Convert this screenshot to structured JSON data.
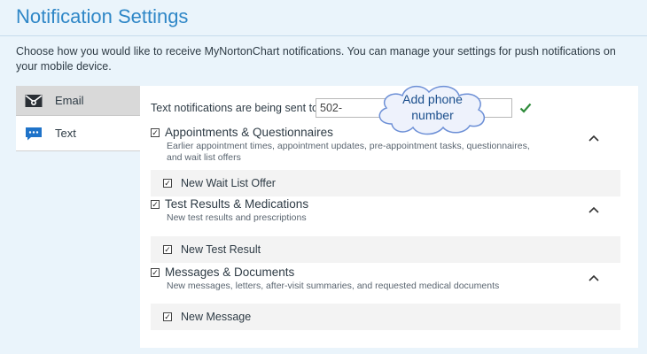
{
  "page": {
    "title": "Notification Settings",
    "intro": "Choose how you would like to receive MyNortonChart notifications. You can manage your settings for push notifications on your mobile device."
  },
  "tabs": [
    {
      "label": "Email",
      "icon": "envelope-icon"
    },
    {
      "label": "Text",
      "icon": "chat-bubble-icon"
    }
  ],
  "text_settings": {
    "send_label": "Text notifications are being sent to:",
    "phone_value": "502-",
    "verified_icon": "check-icon",
    "callout": "Add phone number"
  },
  "sections": [
    {
      "title": "Appointments & Questionnaires",
      "description": "Earlier appointment times, appointment updates, pre-appointment tasks, questionnaires, and wait list offers",
      "sub_label": "New Wait List Offer"
    },
    {
      "title": "Test Results & Medications",
      "description": "New test results and prescriptions",
      "sub_label": "New Test Result"
    },
    {
      "title": "Messages & Documents",
      "description": "New messages, letters, after-visit summaries, and requested medical documents",
      "sub_label": "New Message"
    }
  ],
  "colors": {
    "accent": "#2f87c7",
    "check": "#2e8b3a"
  }
}
